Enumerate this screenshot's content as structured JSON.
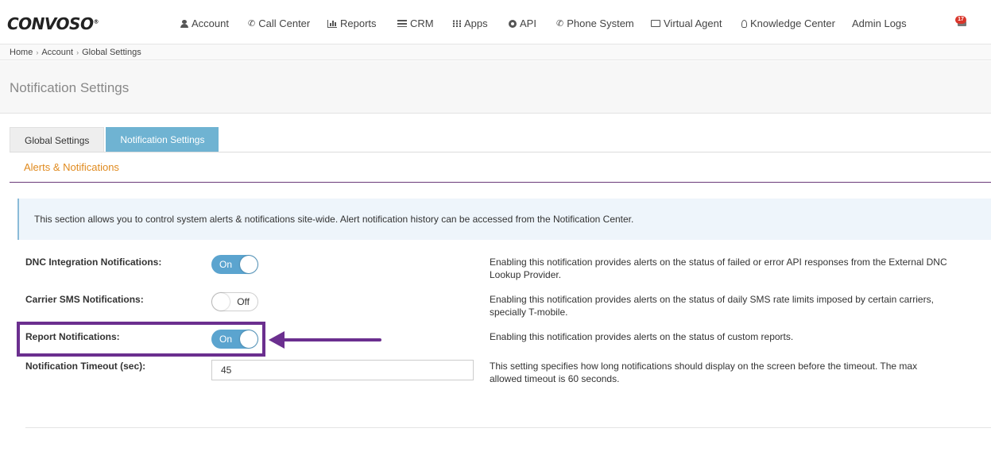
{
  "brand": {
    "logo": "CONVOSO"
  },
  "nav": {
    "items": [
      {
        "label": "Account",
        "icon": "user-icon"
      },
      {
        "label": "Call Center",
        "icon": "phone-icon"
      },
      {
        "label": "Reports",
        "icon": "bar-chart-icon"
      },
      {
        "label": "CRM",
        "icon": "list-icon"
      },
      {
        "label": "Apps",
        "icon": "grid-icon"
      },
      {
        "label": "API",
        "icon": "gear-icon"
      },
      {
        "label": "Phone System",
        "icon": "phone-icon"
      },
      {
        "label": "Virtual Agent",
        "icon": "monitor-icon"
      },
      {
        "label": "Knowledge Center",
        "icon": "lightbulb-icon"
      },
      {
        "label": "Admin Logs",
        "icon": ""
      }
    ],
    "notifications_count": "17"
  },
  "breadcrumb": [
    "Home",
    "Account",
    "Global Settings"
  ],
  "page": {
    "title": "Notification Settings"
  },
  "tabs": [
    {
      "label": "Global Settings",
      "active": false
    },
    {
      "label": "Notification Settings",
      "active": true
    }
  ],
  "section": {
    "title": "Alerts & Notifications"
  },
  "info": "This section allows you to control system alerts & notifications site-wide. Alert notification history can be accessed from the Notification Center.",
  "settings": [
    {
      "label": "DNC Integration Notifications:",
      "state": "On",
      "description": "Enabling this notification provides alerts on the status of failed or error API responses from the External DNC Lookup Provider."
    },
    {
      "label": "Carrier SMS Notifications:",
      "state": "Off",
      "description": "Enabling this notification provides alerts on the status of daily SMS rate limits imposed by certain carriers, specially T-mobile."
    },
    {
      "label": "Report Notifications:",
      "state": "On",
      "description": "Enabling this notification provides alerts on the status of custom reports."
    },
    {
      "label": "Notification Timeout (sec):",
      "value": "45",
      "description": "This setting specifies how long notifications should display on the screen before the timeout. The max allowed timeout is 60 seconds."
    }
  ],
  "colors": {
    "accent_tab": "#6fb3d2",
    "toggle_on": "#5ba4cf",
    "section_title": "#e08a1e",
    "highlight": "#6b2f8f"
  }
}
